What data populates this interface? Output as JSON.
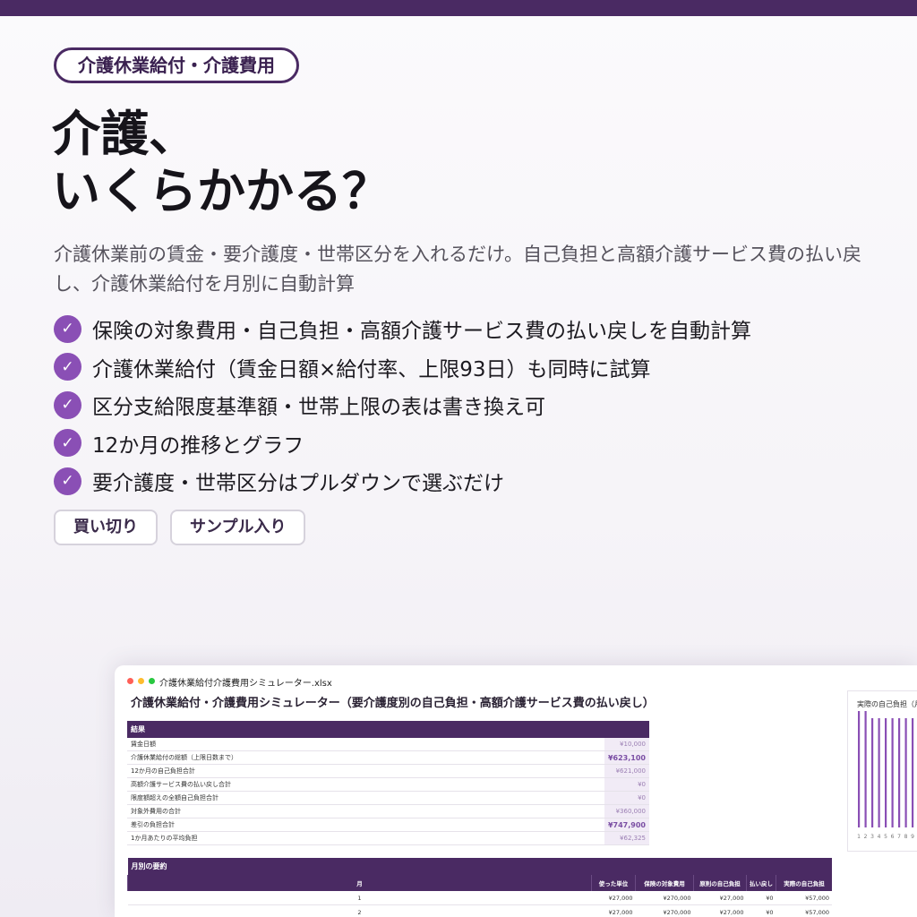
{
  "badge": "介護休業給付・介護費用",
  "headline": {
    "line1": "介護、",
    "line2": "いくらかかる？"
  },
  "lead": "介護休業前の賃金・要介護度・世帯区分を入れるだけ。自己負担と高額介護サービス費の払い戻し、介護休業給付を月別に自動計算",
  "features": [
    "保険の対象費用・自己負担・高額介護サービス費の払い戻しを自動計算",
    "介護休業給付（賃金日額×給付率、上限93日）も同時に試算",
    "区分支給限度基準額・世帯上限の表は書き換え可",
    "12か月の推移とグラフ",
    "要介護度・世帯区分はプルダウンで選ぶだけ"
  ],
  "tags": [
    "買い切り",
    "サンプル入り"
  ],
  "colors": {
    "accent": "#8a4fb5",
    "brand": "#4a2a63"
  },
  "spreadsheet": {
    "filename": "介護休業給付介護費用シミュレーター.xlsx",
    "title": "介護休業給付・介護費用シミュレーター（要介護度別の自己負担・高額介護サービス費の払い戻し）",
    "results": {
      "header": "結果",
      "rows": [
        {
          "label": "賃金日額",
          "value": "¥10,000",
          "bold": false
        },
        {
          "label": "介護休業給付の総額（上限日数まで）",
          "value": "¥623,100",
          "bold": true
        },
        {
          "label": "12か月の自己負担合計",
          "value": "¥621,000",
          "bold": false
        },
        {
          "label": "高額介護サービス費の払い戻し合計",
          "value": "¥0",
          "bold": false
        },
        {
          "label": "限度額超えの全額自己負担合計",
          "value": "¥0",
          "bold": false
        },
        {
          "label": "対象外費用の合計",
          "value": "¥360,000",
          "bold": false
        },
        {
          "label": "差引の負担合計",
          "value": "¥747,900",
          "bold": true
        },
        {
          "label": "1か月あたりの平均負担",
          "value": "¥62,325",
          "bold": false
        }
      ]
    },
    "monthly": {
      "header": "月別の要約",
      "columns": [
        "月",
        "使った単位",
        "保険の対象費用",
        "原則の自己負担",
        "払い戻し",
        "実際の自己負担"
      ],
      "rows": [
        [
          "1",
          "¥27,000",
          "¥270,000",
          "¥27,000",
          "¥0",
          "¥57,000"
        ],
        [
          "2",
          "¥27,000",
          "¥270,000",
          "¥27,000",
          "¥0",
          "¥57,000"
        ]
      ]
    },
    "chart": {
      "title": "実際の自己負担（月",
      "x_ticks": [
        "1",
        "2",
        "3",
        "4",
        "5",
        "6",
        "7",
        "8",
        "9"
      ],
      "accent": "#8a4fb5"
    }
  }
}
